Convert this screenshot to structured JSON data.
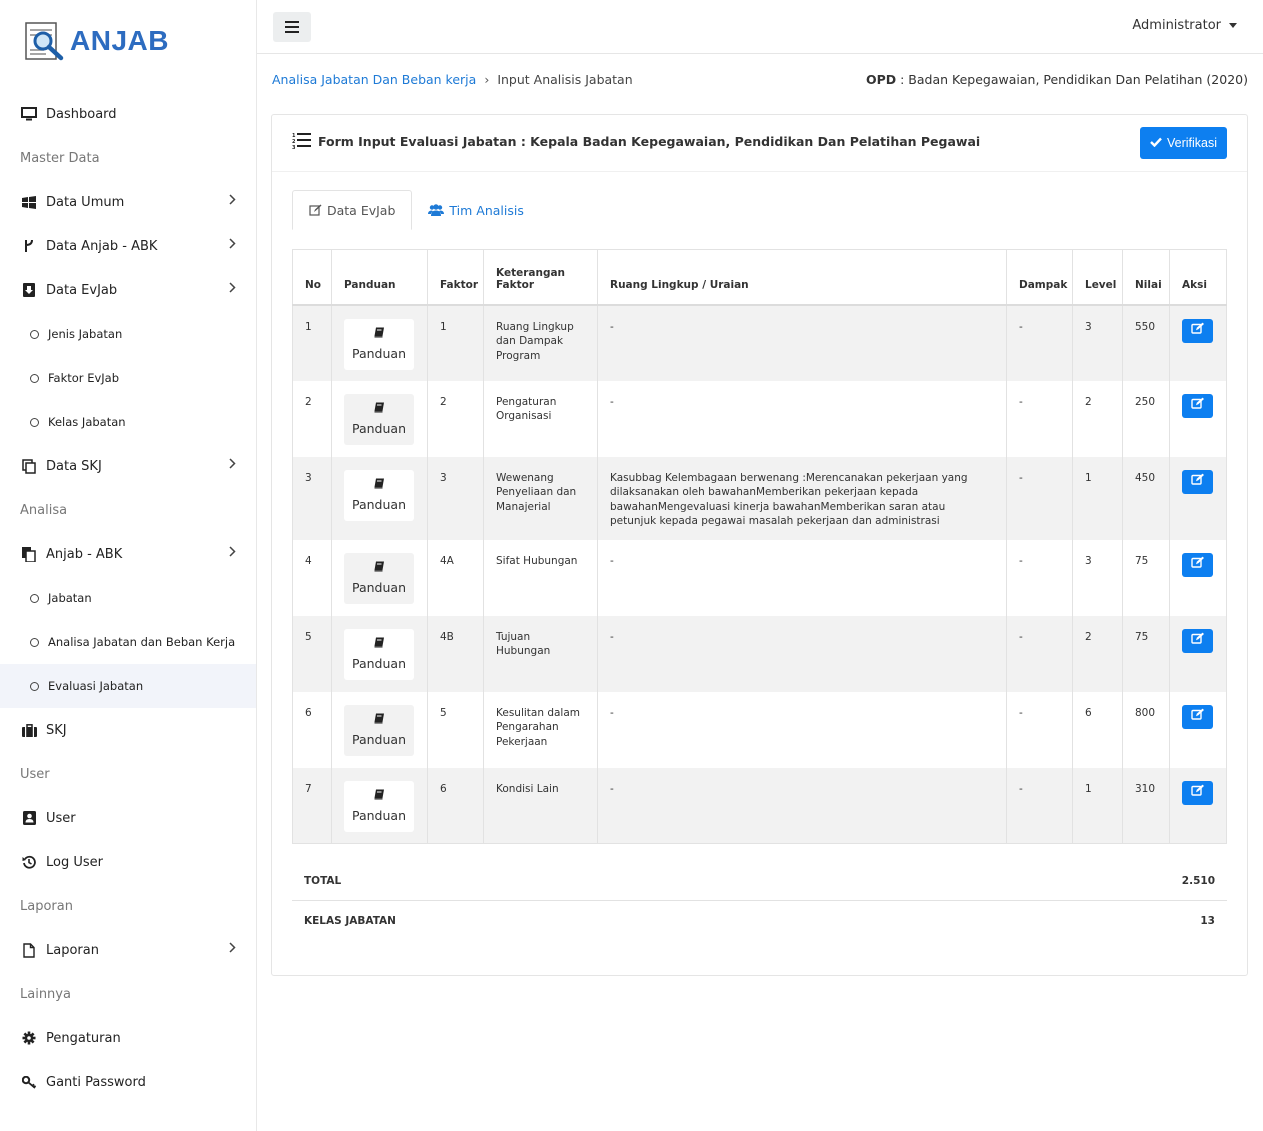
{
  "app": {
    "logo_text": "ANJAB",
    "logo_icon": "magnifier-document-icon"
  },
  "sidebar": {
    "items": [
      {
        "type": "item",
        "label": "Dashboard",
        "icon": "monitor-icon",
        "chevron": false
      },
      {
        "type": "header",
        "label": "Master Data"
      },
      {
        "type": "item",
        "label": "Data Umum",
        "icon": "windows-icon",
        "chevron": true
      },
      {
        "type": "item",
        "label": "Data Anjab - ABK",
        "icon": "fork-icon",
        "chevron": true
      },
      {
        "type": "item",
        "label": "Data EvJab",
        "icon": "book-download-icon",
        "chevron": true
      },
      {
        "type": "sub",
        "label": "Jenis Jabatan"
      },
      {
        "type": "sub",
        "label": "Faktor EvJab"
      },
      {
        "type": "sub",
        "label": "Kelas Jabatan"
      },
      {
        "type": "item",
        "label": "Data SKJ",
        "icon": "copy-icon",
        "chevron": true
      },
      {
        "type": "header",
        "label": "Analisa"
      },
      {
        "type": "item",
        "label": "Anjab - ABK",
        "icon": "files-icon",
        "chevron": true
      },
      {
        "type": "sub",
        "label": "Jabatan"
      },
      {
        "type": "sub",
        "label": "Analisa Jabatan dan Beban Kerja"
      },
      {
        "type": "sub",
        "label": "Evaluasi Jabatan",
        "active": true
      },
      {
        "type": "item",
        "label": "SKJ",
        "icon": "briefcase-icon",
        "chevron": false
      },
      {
        "type": "header",
        "label": "User"
      },
      {
        "type": "item",
        "label": "User",
        "icon": "user-book-icon",
        "chevron": false
      },
      {
        "type": "item",
        "label": "Log User",
        "icon": "history-icon",
        "chevron": false
      },
      {
        "type": "header",
        "label": "Laporan"
      },
      {
        "type": "item",
        "label": "Laporan",
        "icon": "file-icon",
        "chevron": true
      },
      {
        "type": "header",
        "label": "Lainnya"
      },
      {
        "type": "item",
        "label": "Pengaturan",
        "icon": "gear-icon",
        "chevron": false
      },
      {
        "type": "item",
        "label": "Ganti Password",
        "icon": "key-icon",
        "chevron": false
      }
    ]
  },
  "topbar": {
    "user_label": "Administrator"
  },
  "breadcrumb": {
    "parent": "Analisa Jabatan Dan Beban kerja",
    "separator": "›",
    "current": "Input Analisis Jabatan"
  },
  "opd": {
    "label": "OPD",
    "value": ": Badan Kepegawaian, Pendidikan Dan Pelatihan (2020)"
  },
  "card": {
    "title": "Form Input Evaluasi Jabatan : Kepala Badan Kepegawaian, Pendidikan Dan Pelatihan Pegawai",
    "verify_label": "Verifikasi"
  },
  "tabs": [
    {
      "label": "Data EvJab",
      "active": true
    },
    {
      "label": "Tim Analisis",
      "active": false
    }
  ],
  "table": {
    "columns": [
      "No",
      "Panduan",
      "Faktor",
      "Keterangan Faktor",
      "Ruang Lingkup / Uraian",
      "Dampak",
      "Level",
      "Nilai",
      "Aksi"
    ],
    "panduan_label": "Panduan",
    "rows": [
      {
        "no": "1",
        "faktor": "1",
        "keterangan": "Ruang Lingkup dan Dampak Program",
        "uraian": "-",
        "dampak": "-",
        "level": "3",
        "nilai": "550"
      },
      {
        "no": "2",
        "faktor": "2",
        "keterangan": "Pengaturan Organisasi",
        "uraian": "-",
        "dampak": "-",
        "level": "2",
        "nilai": "250"
      },
      {
        "no": "3",
        "faktor": "3",
        "keterangan": "Wewenang Penyeliaan dan Manajerial",
        "uraian": "Kasubbag Kelembagaan berwenang :Merencanakan pekerjaan yang dilaksanakan oleh bawahanMemberikan pekerjaan kepada bawahanMengevaluasi kinerja bawahanMemberikan saran atau petunjuk kepada pegawai masalah pekerjaan dan administrasi",
        "dampak": "-",
        "level": "1",
        "nilai": "450"
      },
      {
        "no": "4",
        "faktor": "4A",
        "keterangan": "Sifat Hubungan",
        "uraian": "-",
        "dampak": "-",
        "level": "3",
        "nilai": "75"
      },
      {
        "no": "5",
        "faktor": "4B",
        "keterangan": "Tujuan Hubungan",
        "uraian": "-",
        "dampak": "-",
        "level": "2",
        "nilai": "75"
      },
      {
        "no": "6",
        "faktor": "5",
        "keterangan": "Kesulitan dalam Pengarahan Pekerjaan",
        "uraian": "-",
        "dampak": "-",
        "level": "6",
        "nilai": "800"
      },
      {
        "no": "7",
        "faktor": "6",
        "keterangan": "Kondisi Lain",
        "uraian": "-",
        "dampak": "-",
        "level": "1",
        "nilai": "310"
      }
    ]
  },
  "totals": {
    "total_label": "TOTAL",
    "total_value": "2.510",
    "kelas_label": "KELAS JABATAN",
    "kelas_value": "13"
  },
  "colors": {
    "primary": "#0d7ff0",
    "link": "#1e7ad6",
    "logo": "#2d6cc0",
    "row_stripe": "#f2f2f2"
  }
}
